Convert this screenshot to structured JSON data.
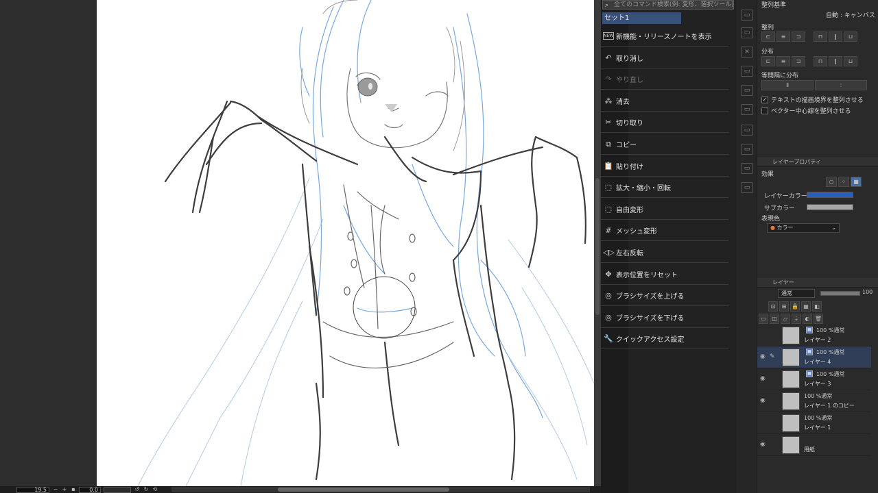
{
  "status_bar": {
    "zoom_value": "19.5",
    "angle_value": "0.0",
    "zoom_minus": "−",
    "zoom_plus": "+"
  },
  "quick_menu": {
    "search_text": "全てのコマンド検索(例: 変形、選択ツール)",
    "set_name": "セット1",
    "items": [
      {
        "label": "新機能・リリースノートを表示",
        "icon": "new-feature-icon",
        "glyph": "NEW",
        "enabled": true
      },
      {
        "label": "取り消し",
        "icon": "undo-icon",
        "glyph": "↶",
        "enabled": true
      },
      {
        "label": "やり直し",
        "icon": "redo-icon",
        "glyph": "↷",
        "enabled": false
      },
      {
        "label": "消去",
        "icon": "clear-icon",
        "glyph": "⁂",
        "enabled": true
      },
      {
        "label": "切り取り",
        "icon": "scissors-icon",
        "glyph": "✂",
        "enabled": true
      },
      {
        "label": "コピー",
        "icon": "copy-icon",
        "glyph": "⧉",
        "enabled": true
      },
      {
        "label": "貼り付け",
        "icon": "paste-icon",
        "glyph": "📋",
        "enabled": true
      },
      {
        "label": "拡大・縮小・回転",
        "icon": "transform-icon",
        "glyph": "⬚",
        "enabled": true
      },
      {
        "label": "自由変形",
        "icon": "free-transform-icon",
        "glyph": "⬚",
        "enabled": true
      },
      {
        "label": "メッシュ変形",
        "icon": "mesh-transform-icon",
        "glyph": "#",
        "enabled": true
      },
      {
        "label": "左右反転",
        "icon": "flip-horizontal-icon",
        "glyph": "◁▷",
        "enabled": true
      },
      {
        "label": "表示位置をリセット",
        "icon": "reset-view-icon",
        "glyph": "✥",
        "enabled": true
      },
      {
        "label": "ブラシサイズを上げる",
        "icon": "brush-size-up-icon",
        "glyph": "◎",
        "enabled": true
      },
      {
        "label": "ブラシサイズを下げる",
        "icon": "brush-size-down-icon",
        "glyph": "◎",
        "enabled": true
      },
      {
        "label": "クイックアクセス設定",
        "icon": "settings-icon",
        "glyph": "🔧",
        "enabled": true
      }
    ]
  },
  "align_panel": {
    "title": "整列基準",
    "basis_value": "自動 : キャンバス",
    "align_label": "整列",
    "distribute_label": "分布",
    "even_spacing_label": "等間隔に分布",
    "check_text_border": "テキストの描画境界を整列させる",
    "check_text_border_checked": true,
    "check_vector_center": "ベクター中心線を整列させる",
    "check_vector_center_checked": false
  },
  "layer_property": {
    "header": "レイヤープロパティ",
    "effect_label": "効果",
    "layer_color_label": "レイヤーカラー",
    "layer_color": "#2a5eb8",
    "sub_color_label": "サブカラー",
    "sub_color": "#a8a8a8",
    "expression_label": "表現色",
    "expression_value": "カラー"
  },
  "layer_panel": {
    "header": "レイヤー",
    "blend_mode": "通常",
    "opacity": "100",
    "layers": [
      {
        "blend": "100 %通常",
        "name": "レイヤー 2",
        "visible": false,
        "selected": false,
        "raster": true
      },
      {
        "blend": "100 %通常",
        "name": "レイヤー 4",
        "visible": true,
        "selected": true,
        "raster": true
      },
      {
        "blend": "100 %通常",
        "name": "レイヤー 3",
        "visible": true,
        "selected": false,
        "raster": true
      },
      {
        "blend": "100 %通常",
        "name": "レイヤー 1 のコピー",
        "visible": true,
        "selected": false,
        "raster": false
      },
      {
        "blend": "100 %通常",
        "name": "レイヤー 1",
        "visible": false,
        "selected": false,
        "raster": false
      },
      {
        "blend": "",
        "name": "用紙",
        "visible": true,
        "selected": false,
        "raster": false
      }
    ]
  },
  "colors": {
    "accent": "#37517a",
    "sketch_blue": "#4a8ad8",
    "sketch_gray": "#555555"
  }
}
